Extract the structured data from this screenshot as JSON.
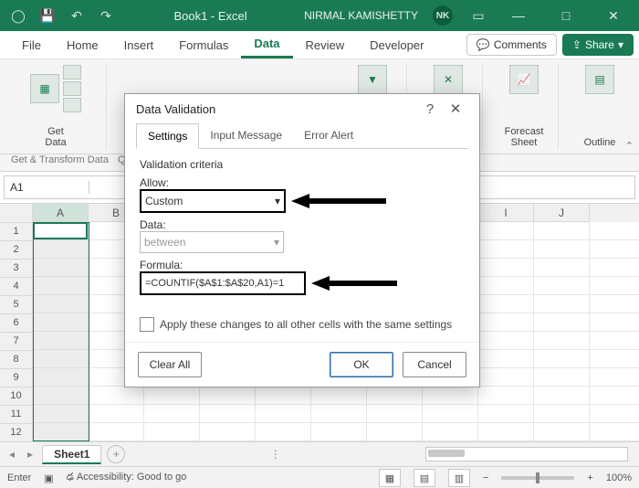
{
  "titlebar": {
    "doc_title": "Book1 - Excel",
    "user_name": "NIRMAL KAMISHETTY",
    "user_initials": "NK"
  },
  "ribbon_tabs": {
    "file": "File",
    "home": "Home",
    "insert": "Insert",
    "formulas": "Formulas",
    "data": "Data",
    "review": "Review",
    "developer": "Developer",
    "comments": "Comments",
    "share": "Share"
  },
  "ribbon_groups": {
    "get_data": "Get\nData",
    "filter": "Filter",
    "forecast": "Forecast\nSheet",
    "outline": "Outline",
    "group1_name": "Get & Transform Data",
    "group2_name": "Qu"
  },
  "namebox": {
    "cell": "A1"
  },
  "sheet": {
    "columns": [
      "A",
      "B",
      "",
      "",
      "",
      "",
      "",
      "",
      "I",
      "J"
    ],
    "rows": [
      "1",
      "2",
      "3",
      "4",
      "5",
      "6",
      "7",
      "8",
      "9",
      "10",
      "11",
      "12"
    ],
    "tab_name": "Sheet1"
  },
  "statusbar": {
    "mode": "Enter",
    "accessibility": "Accessibility: Good to go",
    "zoom": "100%"
  },
  "dialog": {
    "title": "Data Validation",
    "tabs": {
      "settings": "Settings",
      "input_message": "Input Message",
      "error_alert": "Error Alert"
    },
    "section": "Validation criteria",
    "allow_label": "Allow:",
    "allow_value": "Custom",
    "data_label": "Data:",
    "data_value": "between",
    "formula_label": "Formula:",
    "formula_value": "=COUNTIF($A$1:$A$20,A1)=1",
    "apply_label": "Apply these changes to all other cells with the same settings",
    "clear": "Clear All",
    "ok": "OK",
    "cancel": "Cancel"
  }
}
